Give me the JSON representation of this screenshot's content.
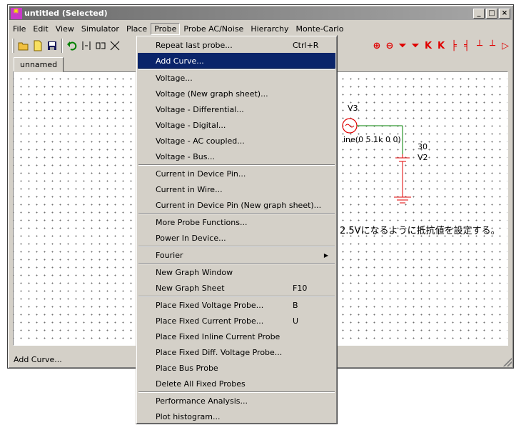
{
  "window": {
    "title": "untitled (Selected)"
  },
  "menubar": [
    {
      "id": "file",
      "label": "File"
    },
    {
      "id": "edit",
      "label": "Edit"
    },
    {
      "id": "view",
      "label": "View"
    },
    {
      "id": "simulator",
      "label": "Simulator"
    },
    {
      "id": "place",
      "label": "Place"
    },
    {
      "id": "probe",
      "label": "Probe"
    },
    {
      "id": "probe-ac-noise",
      "label": "Probe AC/Noise"
    },
    {
      "id": "hierarchy",
      "label": "Hierarchy"
    },
    {
      "id": "monte-carlo",
      "label": "Monte-Carlo"
    }
  ],
  "tabs": [
    {
      "label": "unnamed"
    }
  ],
  "schematic": {
    "v3_label": "V3",
    "v3_value": "ine(0 5.1k 0 0)",
    "v2_value": "30",
    "v2_label": "V2",
    "note": "2.5Vになるように抵抗値を設定する。"
  },
  "status": {
    "text": "Add Curve..."
  },
  "probe_menu": [
    {
      "label": "Repeat last probe...",
      "shortcut": "Ctrl+R"
    },
    {
      "label": "Add Curve...",
      "selected": true
    },
    {
      "sep": true
    },
    {
      "label": "Voltage..."
    },
    {
      "label": "Voltage (New graph sheet)..."
    },
    {
      "label": "Voltage - Differential..."
    },
    {
      "label": "Voltage - Digital..."
    },
    {
      "label": "Voltage - AC coupled..."
    },
    {
      "label": "Voltage - Bus..."
    },
    {
      "sep": true
    },
    {
      "label": "Current in Device Pin..."
    },
    {
      "label": "Current in Wire..."
    },
    {
      "label": "Current in Device Pin (New graph sheet)..."
    },
    {
      "sep": true
    },
    {
      "label": "More Probe Functions..."
    },
    {
      "label": "Power In Device..."
    },
    {
      "sep": true
    },
    {
      "label": "Fourier",
      "submenu": true
    },
    {
      "sep": true
    },
    {
      "label": "New Graph Window"
    },
    {
      "label": "New Graph Sheet",
      "shortcut": "F10"
    },
    {
      "sep": true
    },
    {
      "label": "Place Fixed Voltage Probe...",
      "shortcut": "B"
    },
    {
      "label": "Place Fixed Current Probe...",
      "shortcut": "U"
    },
    {
      "label": "Place Fixed Inline Current Probe"
    },
    {
      "label": "Place Fixed Diff. Voltage Probe..."
    },
    {
      "label": "Place Bus Probe"
    },
    {
      "label": "Delete All Fixed Probes"
    },
    {
      "sep": true
    },
    {
      "label": "Performance Analysis..."
    },
    {
      "label": "Plot histogram..."
    }
  ],
  "colors": {
    "selection": "#0a246a",
    "wire": "#008000",
    "component": "#e00000",
    "face": "#d4d0c8"
  }
}
